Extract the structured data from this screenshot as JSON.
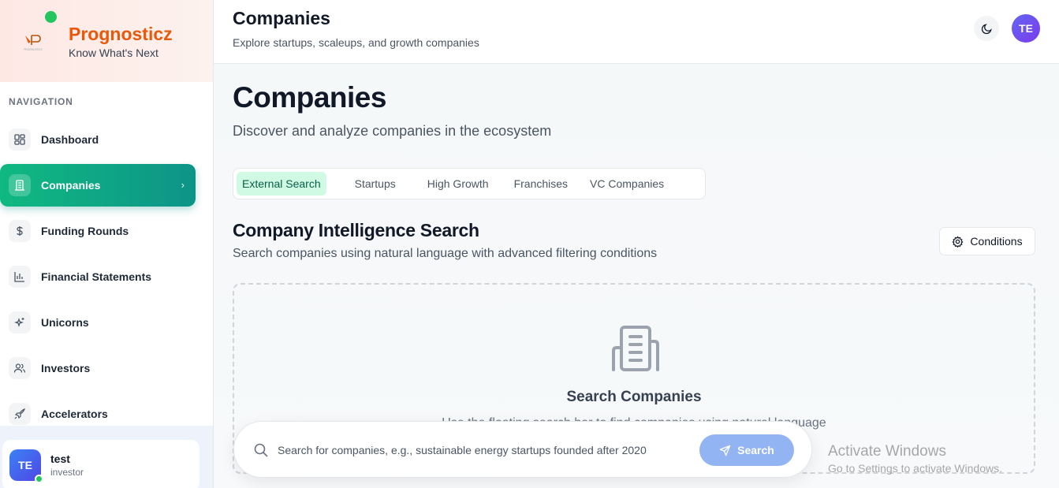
{
  "brand": {
    "name": "Prognosticz",
    "tagline": "Know What's Next",
    "logo_text": "PROGNOSTICZ"
  },
  "sidebar": {
    "heading": "NAVIGATION",
    "items": [
      {
        "label": "Dashboard",
        "icon": "dashboard-icon"
      },
      {
        "label": "Companies",
        "icon": "building-icon",
        "active": true
      },
      {
        "label": "Funding Rounds",
        "icon": "dollar-icon"
      },
      {
        "label": "Financial Statements",
        "icon": "bar-chart-icon"
      },
      {
        "label": "Unicorns",
        "icon": "sparkles-icon"
      },
      {
        "label": "Investors",
        "icon": "users-icon"
      },
      {
        "label": "Accelerators",
        "icon": "rocket-icon"
      }
    ],
    "user": {
      "initials": "TE",
      "name": "test",
      "role": "investor"
    }
  },
  "header": {
    "title": "Companies",
    "subtitle": "Explore startups, scaleups, and growth companies",
    "avatar_initials": "TE"
  },
  "main": {
    "title": "Companies",
    "subtitle": "Discover and analyze companies in the ecosystem",
    "tabs": [
      "External Search",
      "Startups",
      "High Growth",
      "Franchises",
      "VC Companies"
    ],
    "active_tab": "External Search",
    "section_title": "Company Intelligence Search",
    "section_subtitle": "Search companies using natural language with advanced filtering conditions",
    "conditions_label": "Conditions",
    "empty_title": "Search Companies",
    "empty_desc": "Use the floating search bar to find companies using natural language"
  },
  "search": {
    "placeholder": "Search for companies, e.g., sustainable energy startups founded after 2020",
    "button_label": "Search"
  },
  "watermark": {
    "line1": "Activate Windows",
    "line2": "Go to Settings to activate Windows."
  },
  "colors": {
    "accent": "#10b981",
    "brand": "#ea580c",
    "search_button": "#93b4f3"
  }
}
